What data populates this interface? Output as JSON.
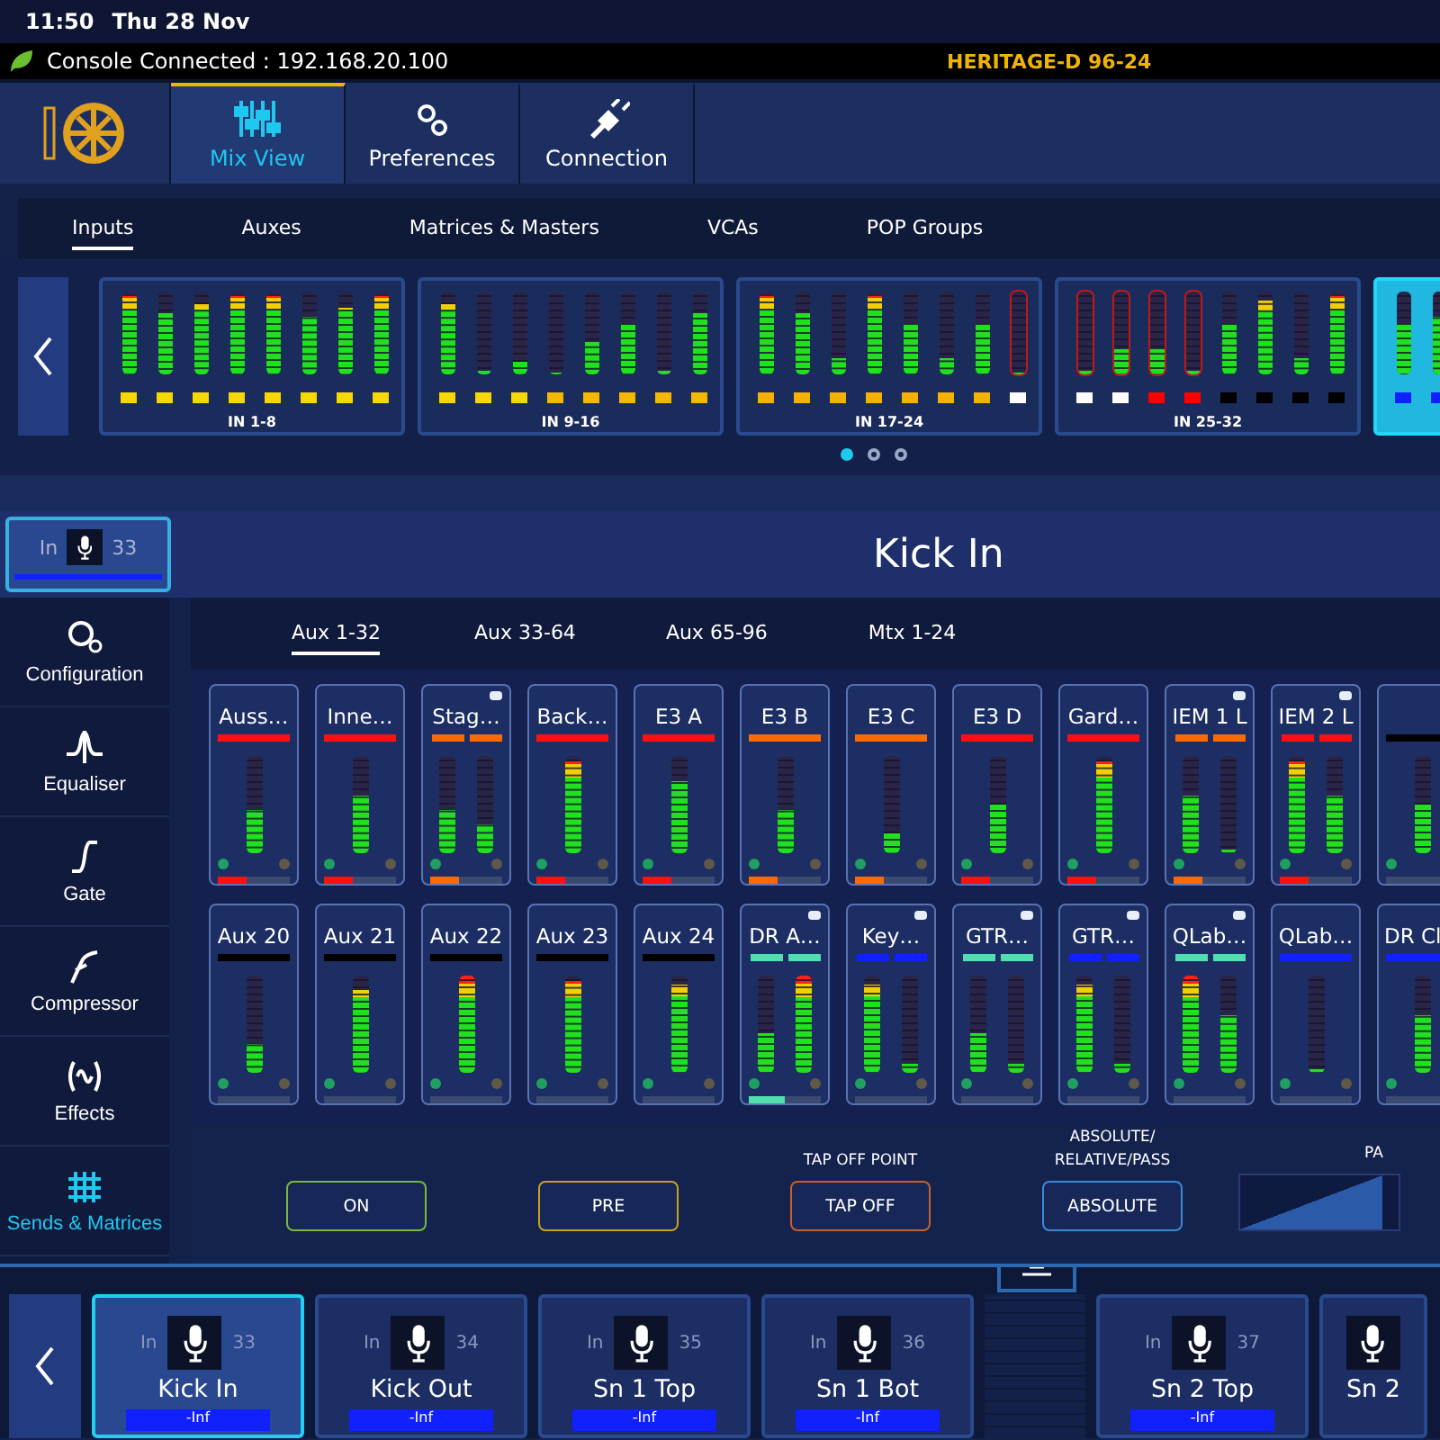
{
  "status_bar": {
    "time": "11:50",
    "date": "Thu 28 Nov"
  },
  "connection_bar": {
    "status": "Console Connected : 192.168.20.100",
    "console": "HERITAGE-D 96-24"
  },
  "nav_tabs": [
    {
      "label": "Mix View",
      "selected": true,
      "kind": "mix"
    },
    {
      "label": "Preferences",
      "selected": false,
      "kind": "prefs"
    },
    {
      "label": "Connection",
      "selected": false,
      "kind": "connection"
    }
  ],
  "section_tabs": [
    {
      "label": "Inputs",
      "selected": true
    },
    {
      "label": "Auxes",
      "selected": false
    },
    {
      "label": "Matrices & Masters",
      "selected": false
    },
    {
      "label": "VCAs",
      "selected": false
    },
    {
      "label": "POP Groups",
      "selected": false
    }
  ],
  "banks": [
    {
      "label": "IN 1-8",
      "selected": false,
      "channels": [
        {
          "level": 0.95,
          "clip": false,
          "color": "#f5d800"
        },
        {
          "level": 0.75,
          "clip": false,
          "color": "#f5d800"
        },
        {
          "level": 0.85,
          "clip": false,
          "color": "#f5d800"
        },
        {
          "level": 0.95,
          "clip": false,
          "color": "#f5d800"
        },
        {
          "level": 0.95,
          "clip": false,
          "color": "#f5d800"
        },
        {
          "level": 0.7,
          "clip": false,
          "color": "#f5d800"
        },
        {
          "level": 0.8,
          "clip": false,
          "color": "#f5d800"
        },
        {
          "level": 0.95,
          "clip": false,
          "color": "#f5d800"
        }
      ]
    },
    {
      "label": "IN 9-16",
      "selected": false,
      "channels": [
        {
          "level": 0.85,
          "clip": false,
          "color": "#f5d800"
        },
        {
          "level": 0.05,
          "clip": false,
          "color": "#f5d800"
        },
        {
          "level": 0.15,
          "clip": false,
          "color": "#f5d800"
        },
        {
          "level": 0.03,
          "clip": false,
          "color": "#f5b800"
        },
        {
          "level": 0.4,
          "clip": false,
          "color": "#f5b800"
        },
        {
          "level": 0.6,
          "clip": false,
          "color": "#f5b800"
        },
        {
          "level": 0.05,
          "clip": false,
          "color": "#f5b800"
        },
        {
          "level": 0.75,
          "clip": false,
          "color": "#f5b800"
        }
      ]
    },
    {
      "label": "IN 17-24",
      "selected": false,
      "channels": [
        {
          "level": 0.95,
          "clip": false,
          "color": "#f5b000"
        },
        {
          "level": 0.75,
          "clip": false,
          "color": "#f5b000"
        },
        {
          "level": 0.2,
          "clip": false,
          "color": "#f5b000"
        },
        {
          "level": 0.95,
          "clip": false,
          "color": "#f5b000"
        },
        {
          "level": 0.6,
          "clip": false,
          "color": "#f5b000"
        },
        {
          "level": 0.2,
          "clip": false,
          "color": "#f5b000"
        },
        {
          "level": 0.6,
          "clip": false,
          "color": "#f5b000"
        },
        {
          "level": 0.03,
          "clip": true,
          "color": "#ffffff"
        }
      ]
    },
    {
      "label": "IN 25-32",
      "selected": false,
      "channels": [
        {
          "level": 0.05,
          "clip": true,
          "color": "#ffffff"
        },
        {
          "level": 0.3,
          "clip": true,
          "color": "#ffffff"
        },
        {
          "level": 0.3,
          "clip": true,
          "color": "#ff0000"
        },
        {
          "level": 0.05,
          "clip": true,
          "color": "#ff0000"
        },
        {
          "level": 0.6,
          "clip": false,
          "color": "#000000"
        },
        {
          "level": 0.9,
          "clip": false,
          "color": "#000000"
        },
        {
          "level": 0.2,
          "clip": false,
          "color": "#000000"
        },
        {
          "level": 0.95,
          "clip": false,
          "color": "#000000"
        }
      ]
    },
    {
      "selected": true,
      "channels": [
        {
          "level": 0.6,
          "clip": false,
          "color": "#1020ff"
        },
        {
          "level": 0.7,
          "clip": false,
          "color": "#1020ff"
        }
      ]
    }
  ],
  "bank_pages": [
    {
      "selected": true
    },
    {
      "selected": false
    },
    {
      "selected": false
    }
  ],
  "channel": {
    "type": "In",
    "number": "33",
    "name": "Kick In"
  },
  "sidebar": [
    {
      "label": "Configuration",
      "kind": "config",
      "selected": false
    },
    {
      "label": "Equaliser",
      "kind": "eq",
      "selected": false
    },
    {
      "label": "Gate",
      "kind": "gate",
      "selected": false
    },
    {
      "label": "Compressor",
      "kind": "comp",
      "selected": false
    },
    {
      "label": "Effects",
      "kind": "fx",
      "selected": false
    },
    {
      "label": "Sends & Matrices",
      "kind": "sends",
      "selected": true
    }
  ],
  "send_tabs": [
    {
      "label": "Aux 1-32",
      "selected": true
    },
    {
      "label": "Aux 33-64",
      "selected": false
    },
    {
      "label": "Aux 65-96",
      "selected": false
    },
    {
      "label": "Mtx 1-24",
      "selected": false
    }
  ],
  "send_rows": [
    [
      {
        "name": "Auss…",
        "color": "#ff1010",
        "linked": false,
        "meters": [
          {
            "level": 0.45
          }
        ],
        "send": {
          "level": 0.4
        }
      },
      {
        "name": "Inne…",
        "color": "#ff1010",
        "linked": false,
        "meters": [
          {
            "level": 0.6
          }
        ],
        "send": {
          "level": 0.4
        }
      },
      {
        "name": "Stag…",
        "color": "#ff6a00",
        "linked": true,
        "meters": [
          {
            "level": 0.45
          },
          {
            "level": 0.3
          }
        ],
        "send": {
          "level": 0.4
        }
      },
      {
        "name": "Back…",
        "color": "#ff1010",
        "linked": false,
        "meters": [
          {
            "level": 0.95
          }
        ],
        "send": {
          "level": 0.4
        }
      },
      {
        "name": "E3 A",
        "color": "#ff1010",
        "linked": false,
        "meters": [
          {
            "level": 0.75
          }
        ],
        "send": {
          "level": 0.4
        }
      },
      {
        "name": "E3 B",
        "color": "#ff6a00",
        "linked": false,
        "meters": [
          {
            "level": 0.45
          }
        ],
        "send": {
          "level": 0.4
        }
      },
      {
        "name": "E3 C",
        "color": "#ff6a00",
        "linked": false,
        "meters": [
          {
            "level": 0.2
          }
        ],
        "send": {
          "level": 0.4
        }
      },
      {
        "name": "E3 D",
        "color": "#ff1010",
        "linked": false,
        "meters": [
          {
            "level": 0.5
          }
        ],
        "send": {
          "level": 0.4
        }
      },
      {
        "name": "Gard…",
        "color": "#ff1010",
        "linked": false,
        "meters": [
          {
            "level": 0.95
          }
        ],
        "send": {
          "level": 0.4
        }
      },
      {
        "name": "IEM 1 L",
        "color": "#ff6a00",
        "linked": true,
        "meters": [
          {
            "level": 0.6
          },
          {
            "level": 0.03
          }
        ],
        "send": {
          "level": 0.4
        }
      },
      {
        "name": "IEM 2 L",
        "color": "#ff1010",
        "linked": true,
        "meters": [
          {
            "level": 0.95
          },
          {
            "level": 0.6
          }
        ],
        "send": {
          "level": 0.4
        }
      },
      {
        "color": "#000000",
        "linked": false,
        "meters": [
          {
            "level": 0.5
          }
        ],
        "send": {
          "level": 0
        }
      }
    ],
    [
      {
        "name": "Aux 20",
        "color": "#000000",
        "linked": false,
        "meters": [
          {
            "level": 0.3
          }
        ],
        "send": {
          "level": 0
        }
      },
      {
        "name": "Aux 21",
        "color": "#000000",
        "linked": false,
        "meters": [
          {
            "level": 0.85
          }
        ],
        "send": {
          "level": 0
        }
      },
      {
        "name": "Aux 22",
        "color": "#000000",
        "linked": false,
        "meters": [
          {
            "level": 1
          }
        ],
        "send": {
          "level": 0
        }
      },
      {
        "name": "Aux 23",
        "color": "#000000",
        "linked": false,
        "meters": [
          {
            "level": 0.95
          }
        ],
        "send": {
          "level": 0
        }
      },
      {
        "name": "Aux 24",
        "color": "#000000",
        "linked": false,
        "meters": [
          {
            "level": 0.9
          }
        ],
        "send": {
          "level": 0
        }
      },
      {
        "name": "DR A…",
        "color": "#50e0b0",
        "linked": true,
        "meters": [
          {
            "level": 0.4
          },
          {
            "level": 1
          }
        ],
        "send": {
          "level": 0.5
        }
      },
      {
        "name": "Key…",
        "color": "#1020ff",
        "linked": true,
        "meters": [
          {
            "level": 0.9
          },
          {
            "level": 0.1
          }
        ],
        "send": {
          "level": 0
        }
      },
      {
        "name": "GTR…",
        "color": "#50e0b0",
        "linked": true,
        "meters": [
          {
            "level": 0.4
          },
          {
            "level": 0.1
          }
        ],
        "send": {
          "level": 0
        }
      },
      {
        "name": "GTR…",
        "color": "#1020ff",
        "linked": true,
        "meters": [
          {
            "level": 0.9
          },
          {
            "level": 0.1
          }
        ],
        "send": {
          "level": 0
        }
      },
      {
        "name": "QLab…",
        "color": "#50e0b0",
        "linked": true,
        "meters": [
          {
            "level": 1
          },
          {
            "level": 0.6
          }
        ],
        "send": {
          "level": 0
        }
      },
      {
        "name": "QLab…",
        "color": "#1020ff",
        "linked": false,
        "meters": [
          {
            "level": 0.03
          }
        ],
        "send": {
          "level": 0
        }
      },
      {
        "name": "DR Cl",
        "color": "#1020ff",
        "linked": false,
        "meters": [
          {
            "level": 0.6
          }
        ],
        "send": {
          "level": 0
        }
      }
    ]
  ],
  "send_controls": [
    {
      "label": "ON",
      "color": "#7ab83a"
    },
    {
      "label": "PRE",
      "color": "#c8a020"
    },
    {
      "caption": "TAP OFF POINT",
      "label": "TAP OFF",
      "color": "#c8602a"
    },
    {
      "caption": "ABSOLUTE/ RELATIVE/PASS",
      "label": "ABSOLUTE",
      "color": "#3a8ad8"
    }
  ],
  "pan": {
    "caption": "PA",
    "level": 0.9
  },
  "strip_cards": [
    {
      "kind": "channel",
      "type": "In",
      "number": "33",
      "name": "Kick In",
      "fader": "-Inf",
      "selected": true
    },
    {
      "kind": "channel",
      "type": "In",
      "number": "34",
      "name": "Kick Out",
      "fader": "-Inf",
      "selected": false
    },
    {
      "kind": "channel",
      "type": "In",
      "number": "35",
      "name": "Sn 1 Top",
      "fader": "-Inf",
      "selected": false
    },
    {
      "kind": "channel",
      "type": "In",
      "number": "36",
      "name": "Sn 1 Bot",
      "fader": "-Inf",
      "selected": false
    },
    {
      "kind": "gap"
    },
    {
      "kind": "channel",
      "type": "In",
      "number": "37",
      "name": "Sn 2 Top",
      "fader": "-Inf",
      "selected": false
    },
    {
      "kind": "partial",
      "name": "Sn 2",
      "selected": false
    }
  ]
}
